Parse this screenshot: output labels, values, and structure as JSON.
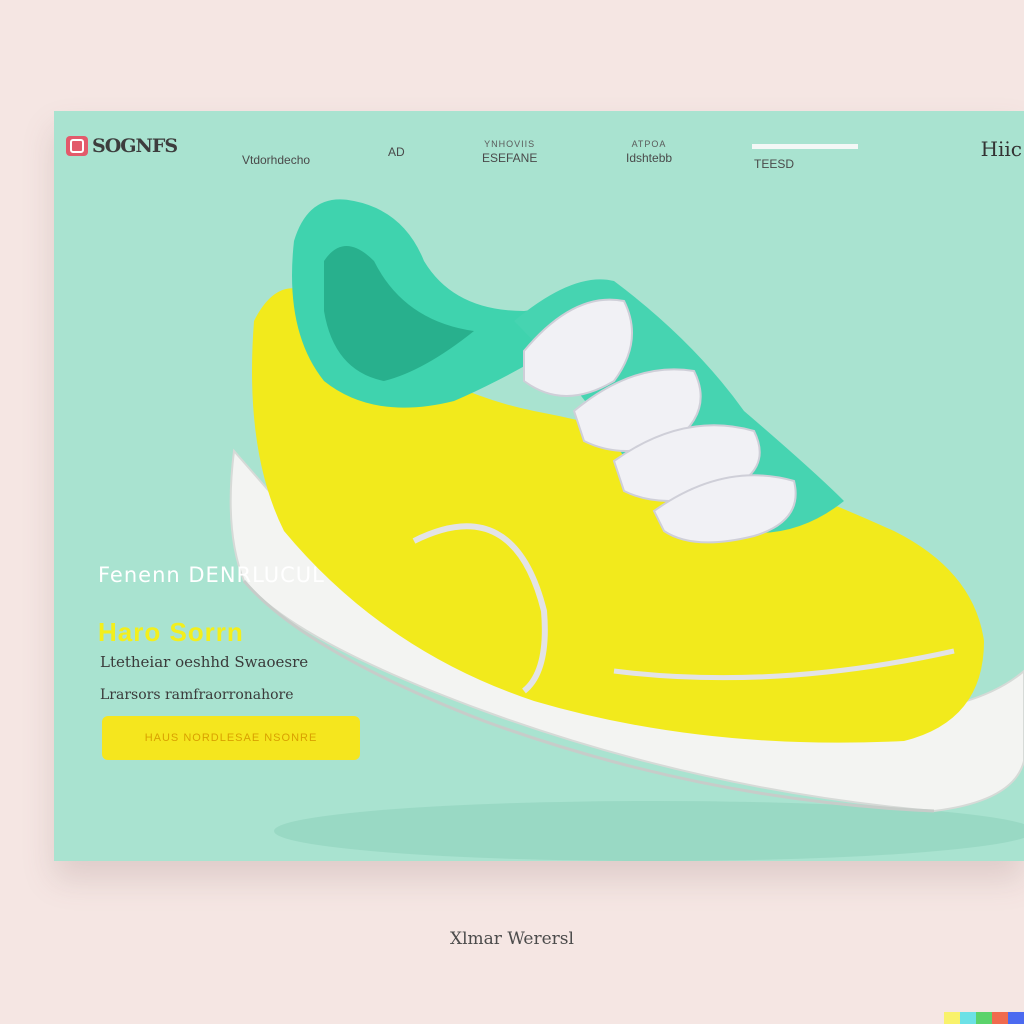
{
  "brand": {
    "logo_text": "SOGNFS",
    "logo_icon": "instagram-like-icon"
  },
  "nav": {
    "items": [
      {
        "sup": "",
        "label": "Vtdorhdecho"
      },
      {
        "sup": "",
        "label": "AD"
      },
      {
        "sup": "YNHOVIIS",
        "label": "ESEFANE"
      },
      {
        "sup": "ATPOA",
        "label": "Idshtebb"
      },
      {
        "sup": "",
        "label": "TEESD"
      }
    ],
    "end_label": "Hiic"
  },
  "hero": {
    "kicker": "Fenenn DENRLUCUL",
    "headline": "Haro Sorrn",
    "description_1": "Ltetheiar oeshhd   Swaoesre",
    "description_2": "Lrarsors ramfraorronahore",
    "cta_label": "HAUS NORDLESAE NSONRE",
    "image_alt": "yellow-teal-sneaker"
  },
  "caption": "Xlmar Werersl",
  "colors": {
    "page_bg": "#f5e6e3",
    "card_bg": "#a9e3d0",
    "accent_yellow": "#f5e61e",
    "accent_teal": "#3fd3ae"
  },
  "watermark_colors": [
    "#f9f26b",
    "#6ce1e6",
    "#5bd36b",
    "#f06a4e",
    "#4c6af0"
  ]
}
